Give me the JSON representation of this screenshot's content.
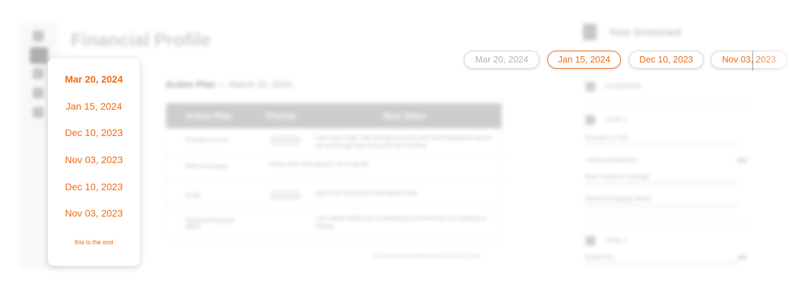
{
  "page": {
    "title": "Financial Profile",
    "subhead_label": "Action Plan",
    "subhead_date": "March 20, 2024"
  },
  "table": {
    "headers": [
      "Action Plan",
      "Priority",
      "Next Steps"
    ],
    "rows": [
      {
        "item": "Emergency Fund",
        "priority": "Watch",
        "steps": "Learn about High Yield Savings Accounts and Cash Equivalents and we can go through them during the next meeting"
      },
      {
        "item": "Debt-to-Earnings",
        "priority": "",
        "steps": "Living, learn more about it, we've got the"
      },
      {
        "item": "Credit",
        "priority": "Watch",
        "steps": "Here is the next level Credit Master Class"
      },
      {
        "item": "Maximize Employer Match",
        "priority": "",
        "steps": "Learn about 401(k) and Considering the percent that your employer is offering"
      }
    ],
    "footnote": "Know more and take expert Total Tip Learn"
  },
  "scorecard": {
    "title": "Your Scorecard",
    "sections": [
      {
        "label": "FOUNDATION"
      },
      {
        "label": "LEVEL 1",
        "items": [
          "Emergency Fund",
          "Credit card balances",
          "Basic insurance coverage",
          "Maximize Employer Match"
        ]
      },
      {
        "label": "LEVEL 2",
        "items": [
          "Estate Plan"
        ]
      }
    ]
  },
  "date_menu": {
    "items": [
      {
        "label": "Mar 20, 2024",
        "selected": true
      },
      {
        "label": "Jan 15, 2024",
        "selected": false
      },
      {
        "label": "Dec 10, 2023",
        "selected": false
      },
      {
        "label": "Nov 03, 2023",
        "selected": false
      },
      {
        "label": "Dec 10, 2023",
        "selected": false
      },
      {
        "label": "Nov 03, 2023",
        "selected": false
      }
    ],
    "end_note": "this is the end"
  },
  "date_tabs": {
    "items": [
      {
        "label": "Mar 20, 2024",
        "state": "faded"
      },
      {
        "label": "Jan 15, 2024",
        "state": "active"
      },
      {
        "label": "Dec 10, 2023",
        "state": "normal"
      },
      {
        "label": "Nov 03, 2023",
        "state": "normal"
      }
    ]
  },
  "colors": {
    "accent": "#ef6a12",
    "muted": "#b3b3b3"
  }
}
